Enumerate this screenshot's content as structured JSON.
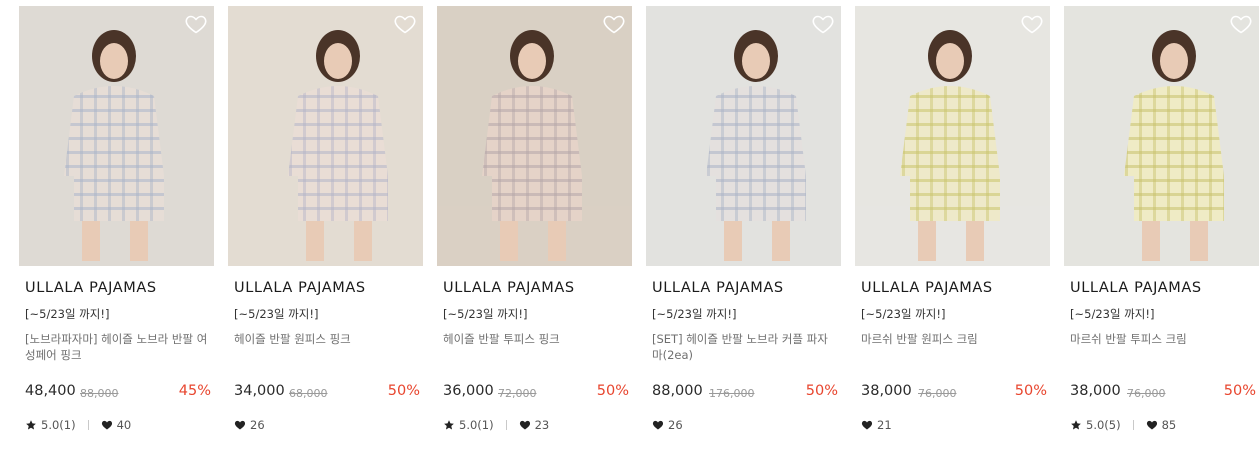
{
  "products": [
    {
      "brand": "ULLALA PAJAMAS",
      "promo": "[~5/23일 까지!]",
      "name": "[노브라파자마] 헤이즐 노브라 반팔 여성페어 핑크",
      "price": "48,400",
      "original_price": "88,000",
      "discount": "45%",
      "rating": "5.0(1)",
      "likes": "40",
      "image_subject": "model in pink plaid short-sleeve shirt and shorts pajama set",
      "image_colors": {
        "bg": "#dedad4",
        "cloth": "#e6ddd6",
        "check": "#a9b4c9"
      }
    },
    {
      "brand": "ULLALA PAJAMAS",
      "promo": "[~5/23일 까지!]",
      "name": "헤이즐 반팔 원피스 핑크",
      "price": "34,000",
      "original_price": "68,000",
      "discount": "50%",
      "rating": "",
      "likes": "26",
      "image_subject": "model seated in pink plaid short-sleeve dress",
      "image_colors": {
        "bg": "#e3dcd2",
        "cloth": "#e9ddd5",
        "check": "#b3b4c8"
      }
    },
    {
      "brand": "ULLALA PAJAMAS",
      "promo": "[~5/23일 까지!]",
      "name": "헤이즐 반팔 투피스 핑크",
      "price": "36,000",
      "original_price": "72,000",
      "discount": "50%",
      "rating": "5.0(1)",
      "likes": "23",
      "image_subject": "model on wooden chair in pink plaid two-piece",
      "image_colors": {
        "bg": "#d9d0c4",
        "cloth": "#e5d3c8",
        "check": "#b4a6a9"
      }
    },
    {
      "brand": "ULLALA PAJAMAS",
      "promo": "[~5/23일 까지!]",
      "name": "[SET] 헤이즐 반팔 노브라 커플 파자마(2ea)",
      "price": "88,000",
      "original_price": "176,000",
      "discount": "50%",
      "rating": "",
      "likes": "26",
      "image_subject": "couple standing in matching plaid pajama sets",
      "image_colors": {
        "bg": "#e2e2df",
        "cloth": "#e4e0de",
        "check": "#a9b3c6"
      }
    },
    {
      "brand": "ULLALA PAJAMAS",
      "promo": "[~5/23일 까지!]",
      "name": "마르쉬 반팔 원피스 크림",
      "price": "38,000",
      "original_price": "76,000",
      "discount": "50%",
      "rating": "",
      "likes": "21",
      "image_subject": "model in cream floral ruffled short-sleeve dress",
      "image_colors": {
        "bg": "#e7e6e1",
        "cloth": "#eee9c9",
        "check": "#c9c46a"
      }
    },
    {
      "brand": "ULLALA PAJAMAS",
      "promo": "[~5/23일 까지!]",
      "name": "마르쉬 반팔 투피스 크림",
      "price": "38,000",
      "original_price": "76,000",
      "discount": "50%",
      "rating": "5.0(5)",
      "likes": "85",
      "image_subject": "model seated in cream floral ruffled two-piece",
      "image_colors": {
        "bg": "#e4e4df",
        "cloth": "#efebc5",
        "check": "#c7c16b"
      }
    }
  ],
  "icons": {
    "wishlist": "heart-outline-icon",
    "rating": "star-icon",
    "likes": "heart-filled-icon"
  },
  "colors": {
    "discount": "#e8462f",
    "brand_text": "#1b1b1b",
    "muted_text": "#6f6f6f"
  }
}
